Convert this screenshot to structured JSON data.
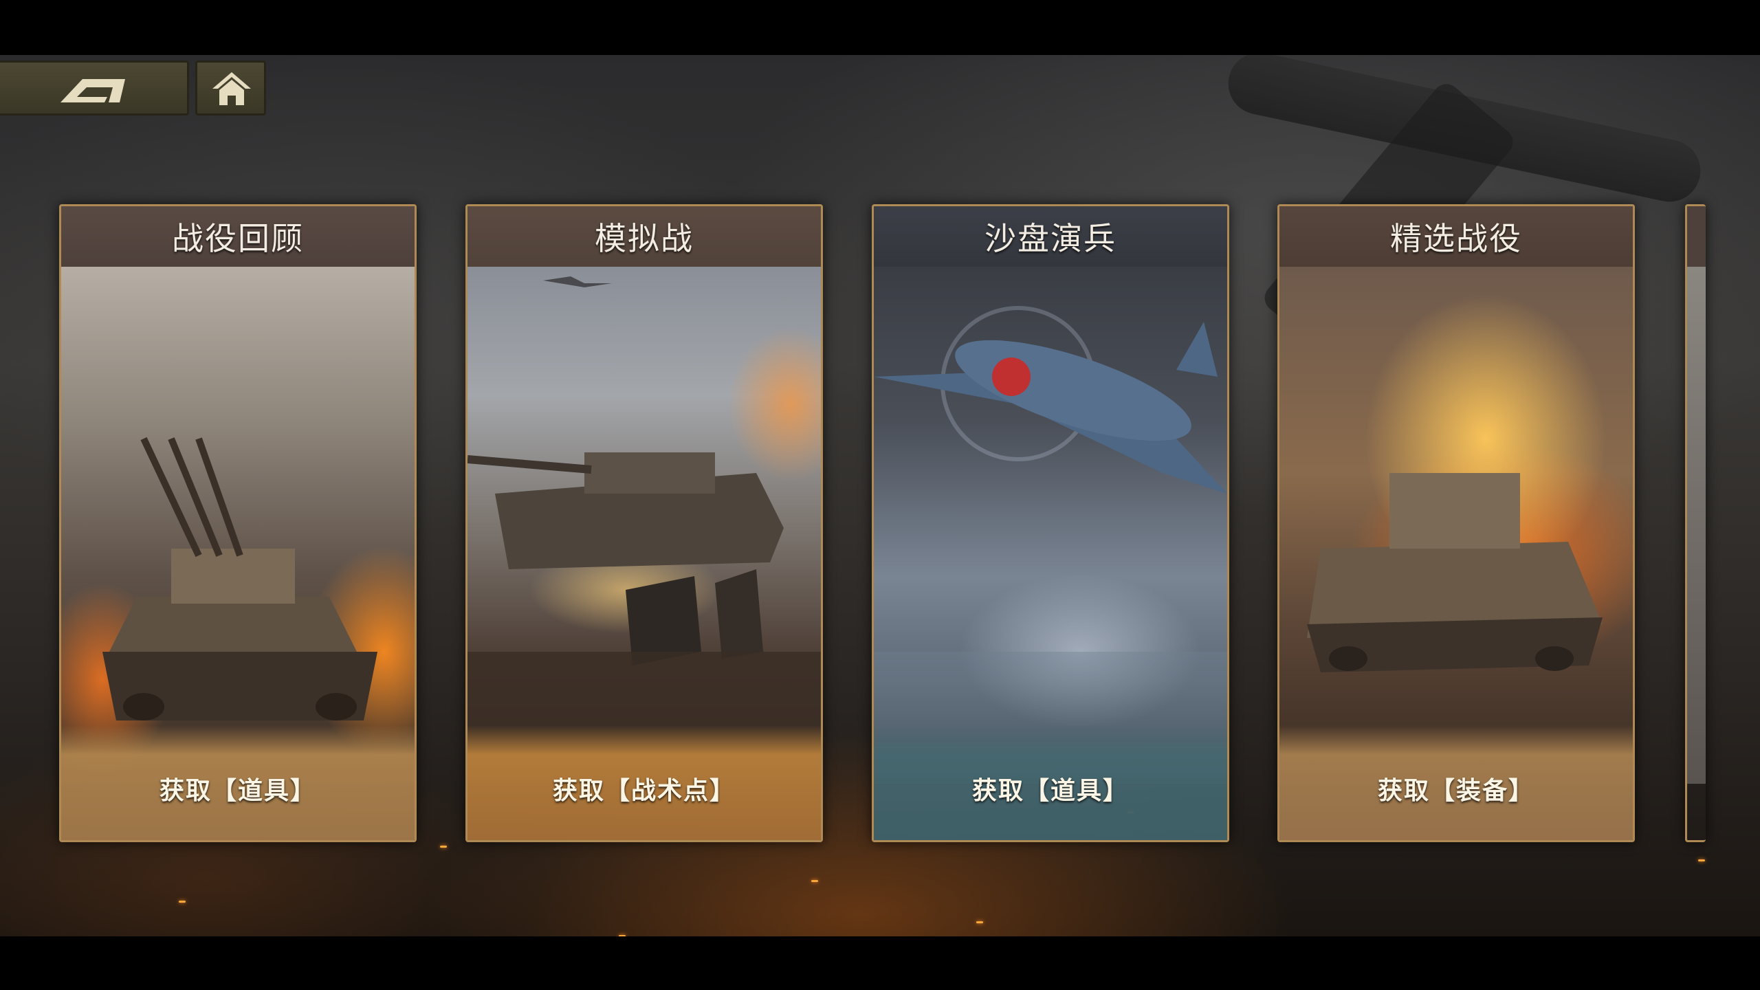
{
  "nav": {
    "back_icon": "back-arrow-icon",
    "home_icon": "home-icon"
  },
  "cards": [
    {
      "title": "战役回顾",
      "reward": "获取【道具】",
      "art": "anti-aircraft-tank-art"
    },
    {
      "title": "模拟战",
      "reward": "获取【战术点】",
      "art": "tank-and-soldiers-art"
    },
    {
      "title": "沙盘演兵",
      "reward": "获取【道具】",
      "art": "fighter-plane-art"
    },
    {
      "title": "精选战役",
      "reward": "获取【装备】",
      "art": "burning-tank-art"
    }
  ],
  "colors": {
    "card_border": "#b08a54",
    "button_bg": "#4c4833",
    "button_icon": "#e6dcc0"
  }
}
